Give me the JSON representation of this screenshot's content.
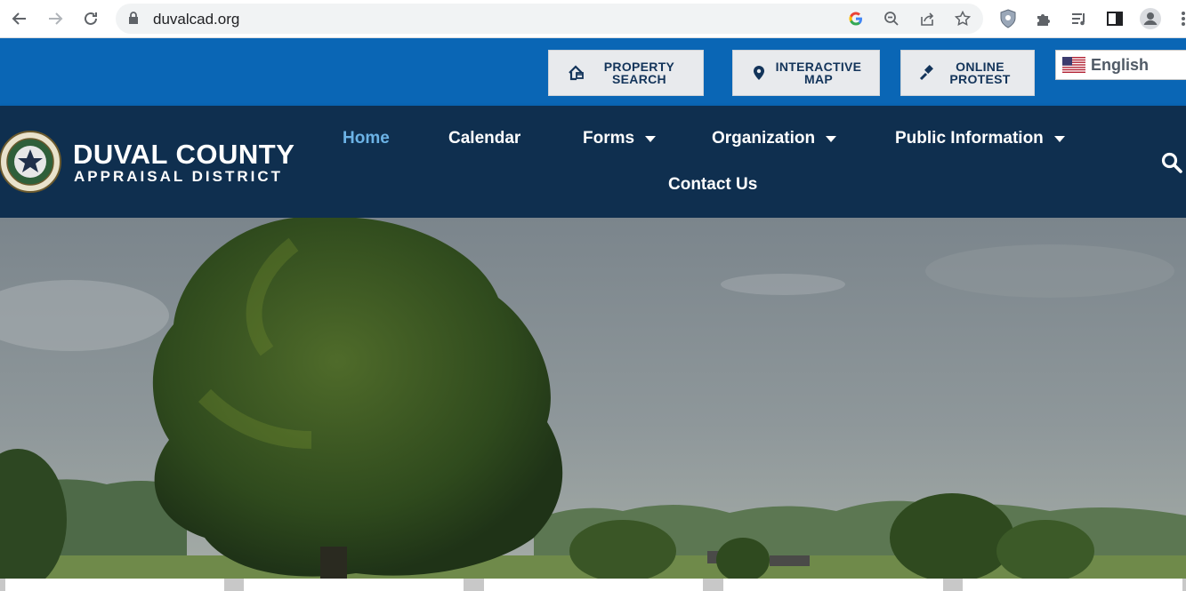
{
  "browser": {
    "url": "duvalcad.org",
    "icons": [
      "back-icon",
      "forward-icon",
      "reload-icon",
      "lock-icon",
      "google-icon",
      "zoom-icon",
      "share-icon",
      "star-icon",
      "shield-extension-icon",
      "puzzle-extension-icon",
      "media-icon",
      "side-panel-icon",
      "profile-icon",
      "kebab-icon"
    ]
  },
  "topbar": {
    "buttons": [
      {
        "label": "PROPERTY\nSEARCH",
        "icon": "house-search-icon"
      },
      {
        "label": "INTERACTIVE\nMAP",
        "icon": "map-pin-icon"
      },
      {
        "label": "ONLINE\nPROTEST",
        "icon": "gavel-icon"
      }
    ],
    "language": {
      "label": "English",
      "icon": "us-flag-icon"
    }
  },
  "brand": {
    "line1": "DUVAL COUNTY",
    "line2": "APPRAISAL DISTRICT"
  },
  "nav": {
    "items": [
      {
        "label": "Home",
        "active": true
      },
      {
        "label": "Calendar"
      },
      {
        "label": "Forms",
        "dropdown": true
      },
      {
        "label": "Organization",
        "dropdown": true
      },
      {
        "label": "Public Information",
        "dropdown": true
      },
      {
        "label": "Contact Us"
      }
    ]
  },
  "colors": {
    "topbar": "#0a66b5",
    "nav": "#0f2f4f",
    "active": "#6cb3e6"
  }
}
